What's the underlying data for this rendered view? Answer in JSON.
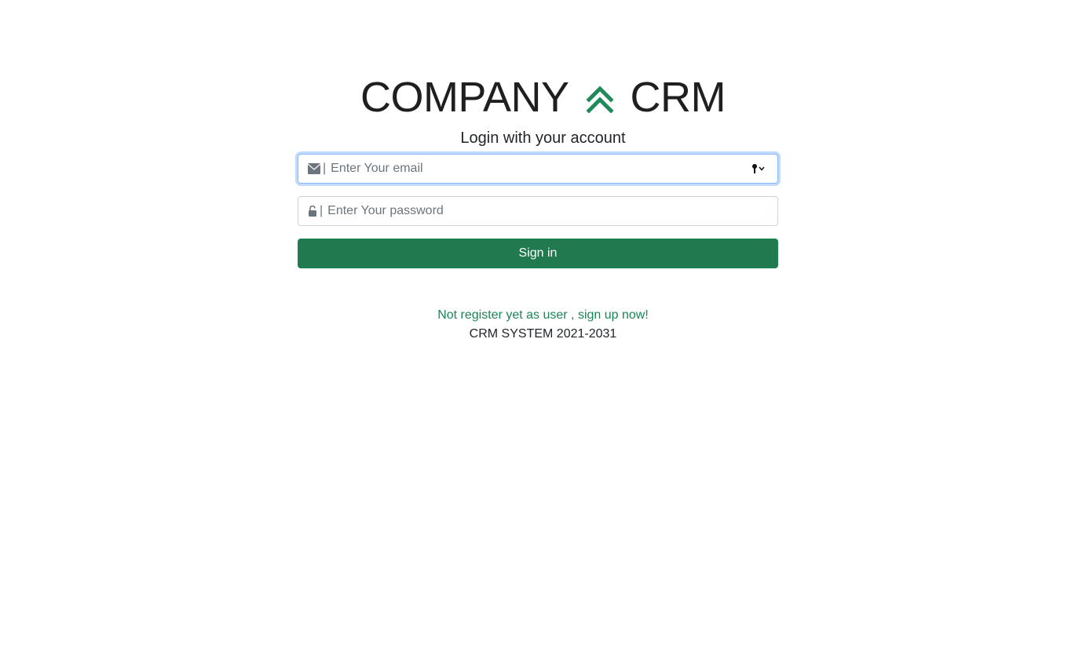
{
  "brand": {
    "left_text": "COMPANY",
    "right_text": "CRM",
    "logo_icon": "double-chevron-up-icon",
    "accent_color": "#198754"
  },
  "login": {
    "subtitle": "Login with your account",
    "email": {
      "icon": "envelope-icon",
      "separator": "|",
      "placeholder": "Enter Your email",
      "value": "",
      "trailing_icon": "key-autofill-icon"
    },
    "password": {
      "icon": "unlock-icon",
      "separator": "|",
      "placeholder": "Enter Your password",
      "value": ""
    },
    "submit_label": "Sign in",
    "button_color": "#217a4f"
  },
  "signup_link_text": "Not register yet as user , sign up now!",
  "footer_text": "CRM SYSTEM 2021-2031"
}
